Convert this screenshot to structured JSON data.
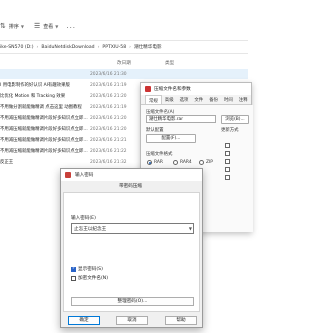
{
  "toolbar": {
    "sort_label": "排序",
    "view_label": "查看",
    "more_label": "..."
  },
  "address": {
    "crumbs": [
      "ike-SN570 (D:)",
      "BaiduNetdiskDownload",
      "PPTXIU-58",
      "潮仕精华电影"
    ]
  },
  "headers": {
    "date": "改日期",
    "type": "类型"
  },
  "files": [
    {
      "name": "",
      "date": "2023/6/16 21:30",
      "selected": true
    },
    {
      "name": "I 用电影制作的好认识 AI有趣效果版",
      "date": "2023/6/16 21:19",
      "selected": false
    },
    {
      "name": "比优化 Motion 和 Tracking 效果",
      "date": "2023/6/16 21:20",
      "selected": false
    },
    {
      "name": "不用做分割就能做精调 点击这里 动图教程",
      "date": "2023/6/16 21:19",
      "selected": false
    },
    {
      "name": "不用减压缩就能做精调片段好多知识点立即…",
      "date": "2023/6/16 21:20",
      "selected": false
    },
    {
      "name": "不用减压缩就能做精调片段好多知识点立即…",
      "date": "2023/6/16 21:20",
      "selected": false
    },
    {
      "name": "不用减压缩就能做精调片段好多知识点立即…",
      "date": "2023/6/16 21:21",
      "selected": false
    },
    {
      "name": "不用减压缩就能做精调片段好多知识点立即…",
      "date": "2023/6/16 21:22",
      "selected": false
    },
    {
      "name": "反正王",
      "date": "2023/6/16 21:32",
      "selected": false
    }
  ],
  "props": {
    "title": "压缩文件名和参数",
    "tabs": [
      "常规",
      "高级",
      "选项",
      "文件",
      "备份",
      "时间",
      "注释"
    ],
    "archive_name_label": "压缩文件名(A)",
    "archive_name_value": "潮仕精华电影.rar",
    "default_config_label": "默认配置",
    "config_button": "配置(F)...",
    "browse_button": "浏览(B)...",
    "update_label": "更新方式",
    "format_label": "压缩文件格式",
    "format_options": [
      "RAR",
      "RAR4",
      "ZIP"
    ],
    "method_label": "压缩方式(C)",
    "method_value": "标准",
    "dict_label": "字典大小(I)",
    "dict_value": "32 MB",
    "split_label": "切分为分卷(V)，大小"
  },
  "password_dialog": {
    "title": "输入密码",
    "tab": "带密码压缩",
    "enter_label": "输入密码(E)",
    "password_value": "止怎王以纪念王",
    "show_password": "显示密码(S)",
    "encrypt_names": "加密文件名(N)",
    "organize_button": "整理密码(O)...",
    "ok_button": "确定",
    "cancel_button": "取消",
    "help_button": "帮助"
  }
}
